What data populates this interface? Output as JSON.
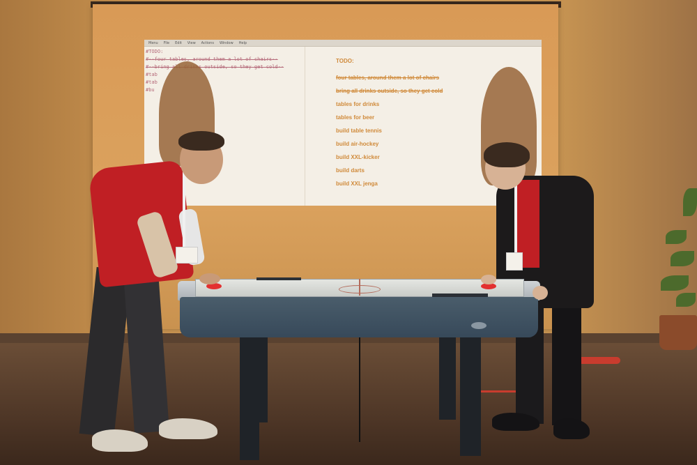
{
  "projection": {
    "menubar_items": [
      "Menu",
      "File",
      "Edit",
      "View",
      "Actions",
      "Window",
      "Help"
    ],
    "code_lines": [
      {
        "text": "#TODO:",
        "struck": false
      },
      {
        "text": "#--four tables, around them a lot of chairs--",
        "struck": true
      },
      {
        "text": "#--bring all drinks outside, so they get cold--",
        "struck": true
      },
      {
        "text": "#tab",
        "struck": false
      },
      {
        "text": "#tab",
        "struck": false
      },
      {
        "text": "#bu",
        "struck": false
      }
    ],
    "todo": {
      "title": "TODO:",
      "items": [
        {
          "text": "four tables, around them a lot of chairs",
          "done": true
        },
        {
          "text": "bring all drinks outside, so they get cold",
          "done": true
        },
        {
          "text": "tables for drinks",
          "done": false
        },
        {
          "text": "tables for beer",
          "done": false
        },
        {
          "text": "build table tennis",
          "done": false
        },
        {
          "text": "build air-hockey",
          "done": false
        },
        {
          "text": "build XXL-kicker",
          "done": false
        },
        {
          "text": "build darts",
          "done": false
        },
        {
          "text": "build XXL jenga",
          "done": false
        }
      ]
    }
  },
  "colors": {
    "todo_text": "#d08a3a",
    "code_text": "#b56a7a",
    "mallet": "#e33030",
    "shirt_red": "#c01f24",
    "jacket_black": "#1c1a1b"
  },
  "icons": [
    "air-hockey-table",
    "mallet",
    "plant"
  ]
}
